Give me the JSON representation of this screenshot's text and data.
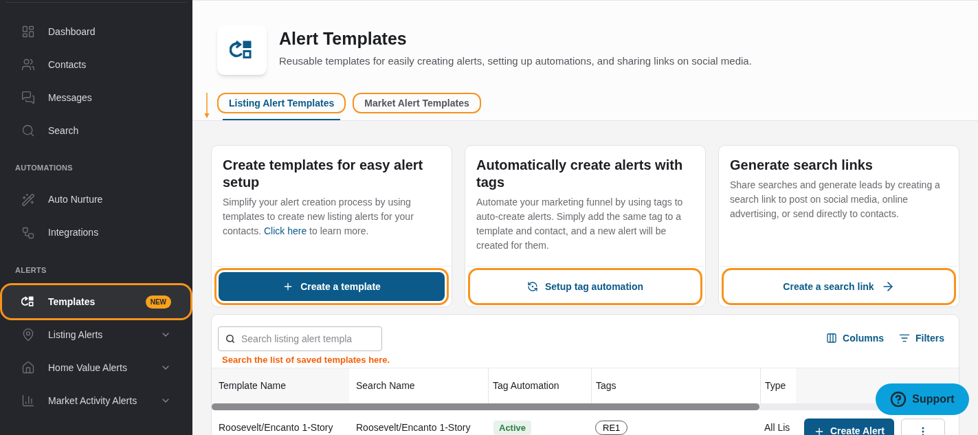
{
  "sidebar": {
    "sections": [
      {
        "items": [
          {
            "label": "Dashboard",
            "selected": false
          },
          {
            "label": "Contacts",
            "selected": false
          },
          {
            "label": "Messages",
            "selected": false
          },
          {
            "label": "Search",
            "selected": false
          }
        ]
      },
      {
        "heading": "AUTOMATIONS",
        "items": [
          {
            "label": "Auto Nurture",
            "selected": false
          },
          {
            "label": "Integrations",
            "selected": false
          }
        ]
      },
      {
        "heading": "ALERTS",
        "items": [
          {
            "label": "Templates",
            "selected": true,
            "badge": "NEW",
            "highlighted": true
          },
          {
            "label": "Listing Alerts",
            "selected": false,
            "expandable": true
          },
          {
            "label": "Home Value Alerts",
            "selected": false,
            "expandable": true
          },
          {
            "label": "Market Activity Alerts",
            "selected": false,
            "expandable": true
          }
        ]
      }
    ]
  },
  "header": {
    "title": "Alert Templates",
    "subtitle": "Reusable templates for easily creating alerts, setting up automations, and sharing links on social media."
  },
  "tabs": [
    {
      "label": "Listing Alert Templates",
      "selected": true,
      "highlighted": true
    },
    {
      "label": "Market Alert Templates",
      "selected": false,
      "highlighted": true
    }
  ],
  "cards": [
    {
      "title": "Create templates for easy alert setup",
      "text": "Simplify your alert creation process by using templates to create new listing alerts for your contacts.",
      "link": "Click here",
      "text_after": "to learn more.",
      "button": {
        "label": "Create a template",
        "kind": "primary",
        "highlighted": true
      }
    },
    {
      "title": "Automatically create alerts with tags",
      "text": "Automate your marketing funnel by using tags to auto-create alerts. Simply add the same tag to a template and contact, and a new alert will be created for them.",
      "button": {
        "label": "Setup tag automation",
        "kind": "secondary",
        "highlighted": true
      }
    },
    {
      "title": "Generate search links",
      "text": "Share searches and generate leads by creating a search link to post on social media, online advertising, or send directly to contacts.",
      "button": {
        "label": "Create a search link",
        "kind": "secondary",
        "highlighted": true
      }
    }
  ],
  "table": {
    "search": {
      "placeholder": "Search listing alert templa"
    },
    "hint": "Search the list of saved templates here.",
    "toolbar": [
      "Columns",
      "Filters"
    ],
    "columns": [
      "Template Name",
      "Search Name",
      "Tag Automation",
      "Tags",
      "Type"
    ],
    "rows": [
      {
        "template_name": "Roosevelt/Encanto 1-Story",
        "search_name": "Roosevelt/Encanto 1-Story",
        "tag_automation": "Active",
        "tags": "RE1",
        "type": "All Lis",
        "action": "Create Alert"
      }
    ]
  },
  "support": {
    "label": "Support"
  }
}
